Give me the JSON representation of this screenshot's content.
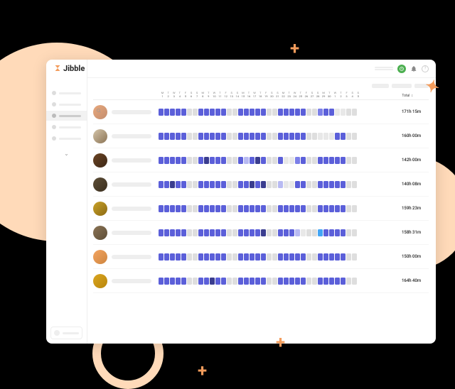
{
  "app": {
    "name": "Jibble"
  },
  "header": {
    "live_badge": "•",
    "help": "?"
  },
  "table": {
    "total_label": "Total",
    "sort_label": "↕",
    "day_letters": [
      "M",
      "T",
      "W",
      "T",
      "F",
      "S",
      "S",
      "M",
      "T",
      "W",
      "T",
      "F",
      "S",
      "S",
      "M",
      "T",
      "W",
      "T",
      "F",
      "S",
      "S",
      "M",
      "T",
      "W",
      "T",
      "F",
      "S",
      "S",
      "M",
      "T",
      "W",
      "T",
      "F",
      "S",
      "S"
    ],
    "day_nums": [
      "1",
      "2",
      "3",
      "4",
      "5",
      "6",
      "7",
      "8",
      "9",
      "10",
      "11",
      "12",
      "13",
      "14",
      "15",
      "16",
      "17",
      "18",
      "19",
      "20",
      "21",
      "22",
      "23",
      "24",
      "25",
      "26",
      "27",
      "28",
      "29",
      "30",
      "1",
      "2",
      "3",
      "4",
      "5"
    ]
  },
  "rows": [
    {
      "total": "171h 15m",
      "avatar": "linear-gradient(135deg,#e8a87c,#c38d6e)",
      "cells": "fffffggfffffggfffffggfffffggmffeegg"
    },
    {
      "total": "160h 00m",
      "avatar": "linear-gradient(135deg,#d4c5a9,#8b7355)",
      "cells": "fffffggfffffggfffffggfffffggeeeffgg"
    },
    {
      "total": "142h 00m",
      "avatar": "linear-gradient(135deg,#6b4423,#3d2817)",
      "cells": "fffffggfdfffggflfdfggfeemfggfffffgg"
    },
    {
      "total": "140h 08m",
      "avatar": "linear-gradient(135deg,#5d4e37,#3b2f1f)",
      "cells": "ffdffggfffffggffdfdggleeffggfffffgg"
    },
    {
      "total": "159h 23m",
      "avatar": "linear-gradient(135deg,#c9a227,#8b6914)",
      "cells": "fffffggfffffggfffffggfffffggfffffgg"
    },
    {
      "total": "158h 31m",
      "avatar": "linear-gradient(135deg,#8b7355,#5d4e37)",
      "cells": "fffffggfffffggffffdggfffleggtffffgg"
    },
    {
      "total": "150h 00m",
      "avatar": "linear-gradient(135deg,#f4a460,#cd853f)",
      "cells": "fffffggfffffggfffffggfffffggfffffgg"
    },
    {
      "total": "164h 40m",
      "avatar": "linear-gradient(135deg,#daa520,#b8860b)",
      "cells": "fffffggffdffggfffffggfffffggfffffgg"
    }
  ]
}
